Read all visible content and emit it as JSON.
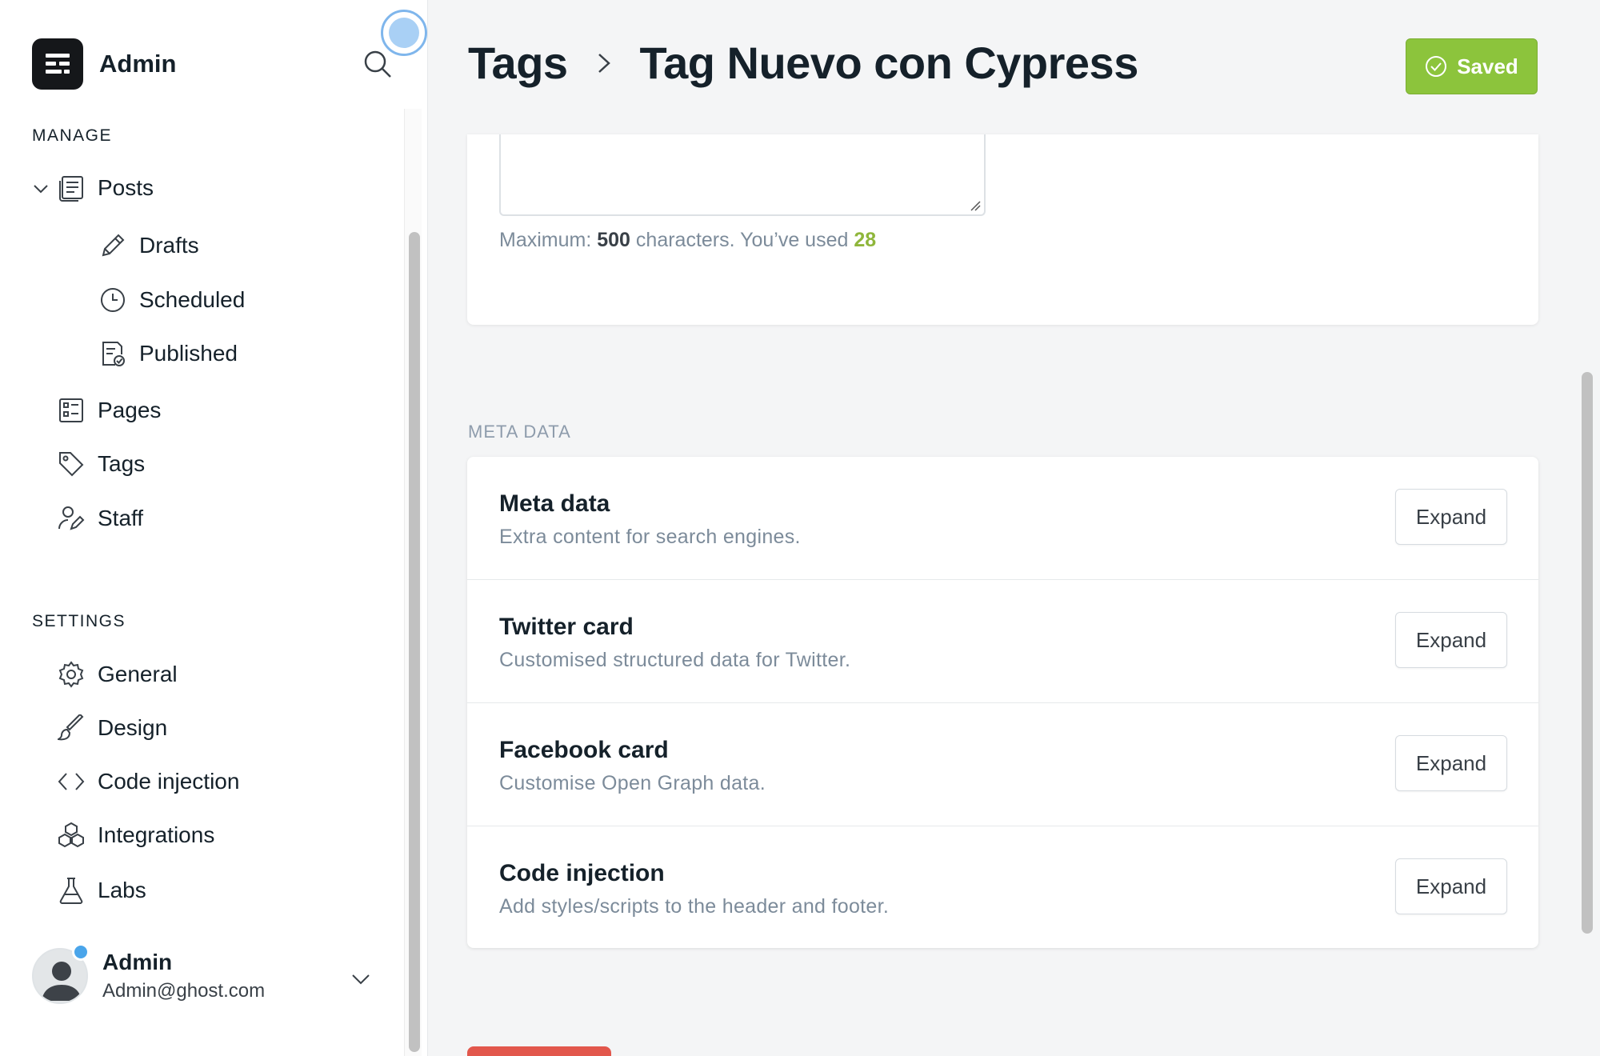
{
  "sidebar": {
    "brand_name": "Admin",
    "manage_title": "MANAGE",
    "settings_title": "SETTINGS",
    "manage_items": [
      {
        "label": "Posts",
        "icon": "posts-icon"
      },
      {
        "label": "Drafts",
        "icon": "pencil-icon"
      },
      {
        "label": "Scheduled",
        "icon": "clock-icon"
      },
      {
        "label": "Published",
        "icon": "published-icon"
      },
      {
        "label": "Pages",
        "icon": "pages-icon"
      },
      {
        "label": "Tags",
        "icon": "tag-icon"
      },
      {
        "label": "Staff",
        "icon": "staff-icon"
      }
    ],
    "settings_items": [
      {
        "label": "General",
        "icon": "gear-icon"
      },
      {
        "label": "Design",
        "icon": "brush-icon"
      },
      {
        "label": "Code injection",
        "icon": "code-icon"
      },
      {
        "label": "Integrations",
        "icon": "cubes-icon"
      },
      {
        "label": "Labs",
        "icon": "flask-icon"
      }
    ],
    "user": {
      "name": "Admin",
      "email": "Admin@ghost.com"
    }
  },
  "header": {
    "breadcrumb_parent": "Tags",
    "breadcrumb_current": "Tag Nuevo con Cypress",
    "save_label": "Saved"
  },
  "description_field": {
    "hint_prefix": "Maximum:",
    "max_chars": "500",
    "hint_middle": "characters. You’ve used",
    "used_chars": "28"
  },
  "meta_section": {
    "label": "META DATA",
    "rows": [
      {
        "title": "Meta data",
        "desc": "Extra content for search engines.",
        "button": "Expand"
      },
      {
        "title": "Twitter card",
        "desc": "Customised structured data for Twitter.",
        "button": "Expand"
      },
      {
        "title": "Facebook card",
        "desc": "Customise Open Graph data.",
        "button": "Expand"
      },
      {
        "title": "Code injection",
        "desc": "Add styles/scripts to the header and footer.",
        "button": "Expand"
      }
    ]
  },
  "colors": {
    "accent_green": "#8cc43c",
    "used_count_green": "#8fb63b",
    "delete_red": "#e2574c",
    "notification_blue": "#4aa5ea"
  }
}
